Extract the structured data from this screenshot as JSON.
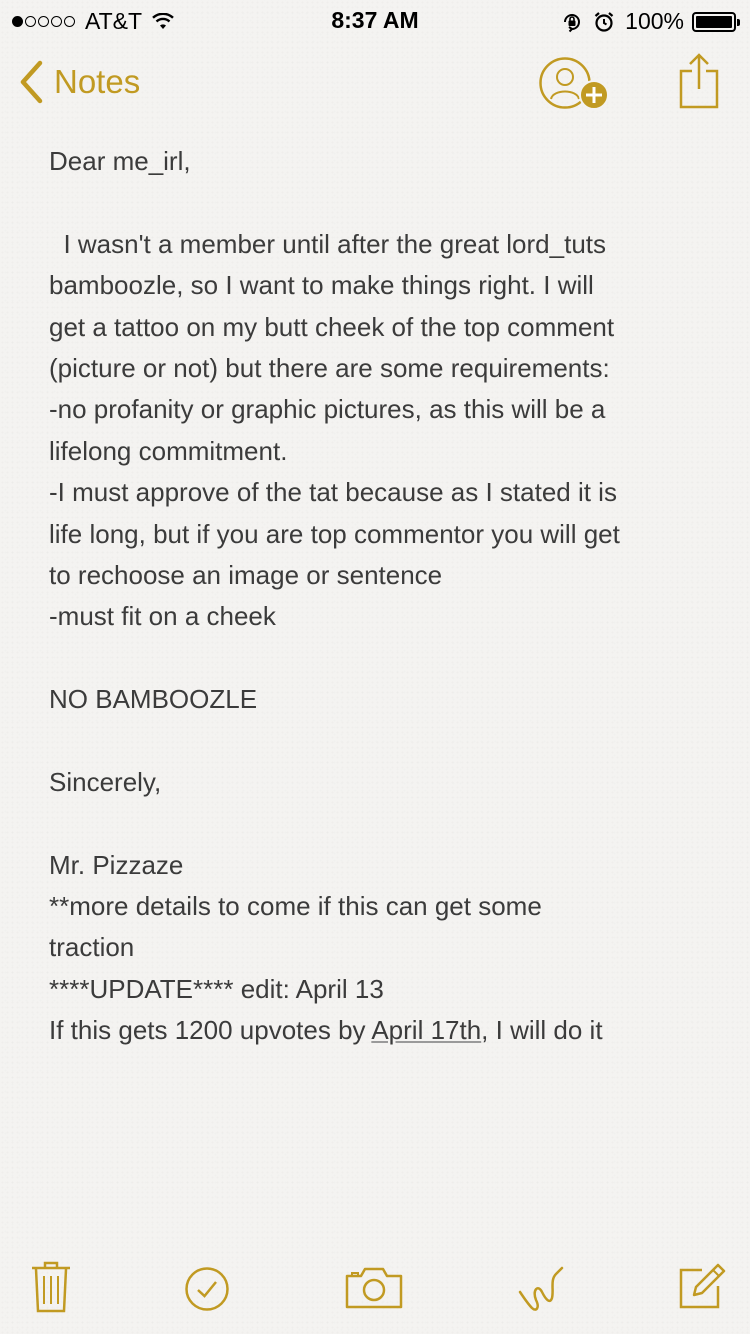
{
  "status_bar": {
    "carrier": "AT&T",
    "time": "8:37 AM",
    "battery": "100%",
    "signal_bars": 1,
    "signal_total": 5
  },
  "nav": {
    "back_label": "Notes",
    "accent_color": "#c19a22"
  },
  "note": {
    "lines": [
      "Dear me_irl,",
      "",
      "  I wasn't a member until after the great lord_tuts",
      "bamboozle, so I want to make things right. I will",
      "get a tattoo on my butt cheek of the top comment",
      "(picture or not) but there are some requirements:",
      "-no profanity or graphic pictures, as this will be a",
      "lifelong commitment.",
      "-I must approve of the tat because as I stated it is",
      "life long, but if you are top commentor you will get",
      "to rechoose an image or sentence",
      "-must fit on a cheek",
      "",
      "NO BAMBOOZLE",
      "",
      "Sincerely,",
      "",
      "Mr. Pizzaze",
      "**more details to come if this can get some",
      "traction",
      "****UPDATE**** edit: April 13"
    ],
    "last_line_before": "If this gets 1200 upvotes by ",
    "last_line_link": "April 17th",
    "last_line_after": ", I will do it"
  },
  "toolbar": {
    "icons": [
      "trash-icon",
      "checklist-icon",
      "camera-icon",
      "sketch-icon",
      "compose-icon"
    ]
  }
}
